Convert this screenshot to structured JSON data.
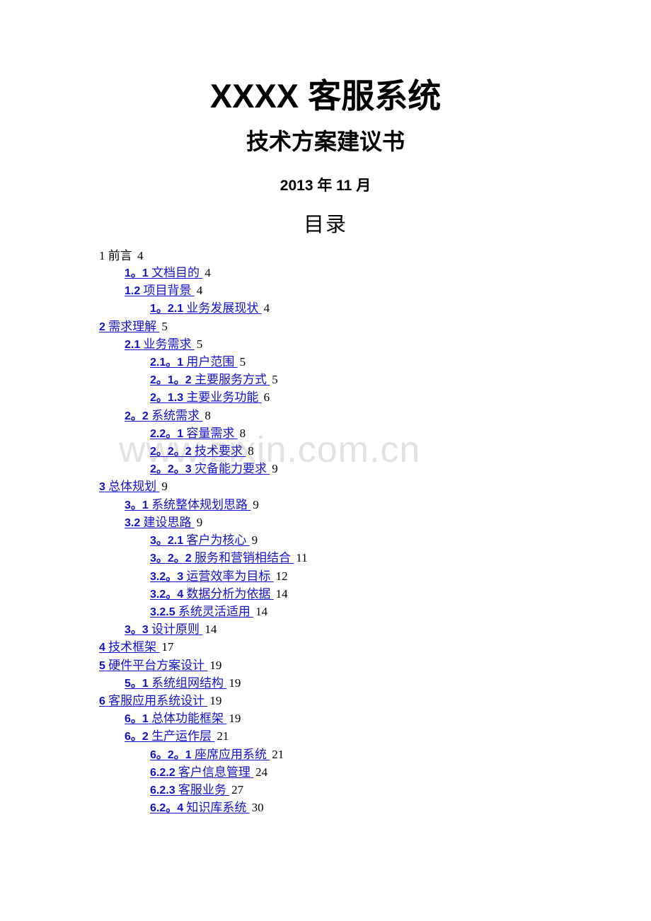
{
  "document": {
    "title": "XXXX 客服系统",
    "subtitle": "技术方案建议书",
    "date": "2013 年 11 月",
    "toc_heading": "目录",
    "watermark": "www.zixin.com.cn",
    "link_color": "#1111cc",
    "text_color": "#000000",
    "watermark_color": "#e2e2e2"
  },
  "toc": {
    "entries": [
      {
        "level": 1,
        "num": "1",
        "text": "前言",
        "page": "4",
        "link": false
      },
      {
        "level": 2,
        "num": "1。1",
        "text": "文档目的",
        "page": "4",
        "link": true
      },
      {
        "level": 2,
        "num": "1.2",
        "text": "项目背景",
        "page": "4",
        "link": true
      },
      {
        "level": 3,
        "num": "1。2.1",
        "text": "业务发展现状",
        "page": "4",
        "link": true
      },
      {
        "level": 1,
        "num": "2",
        "text": "需求理解",
        "page": "5",
        "link": true
      },
      {
        "level": 2,
        "num": "2.1",
        "text": "业务需求",
        "page": "5",
        "link": true
      },
      {
        "level": 3,
        "num": "2.1。1",
        "text": "用户范围",
        "page": "5",
        "link": true
      },
      {
        "level": 3,
        "num": "2。1。2",
        "text": "主要服务方式",
        "page": "5",
        "link": true
      },
      {
        "level": 3,
        "num": "2。1.3",
        "text": "主要业务功能",
        "page": "6",
        "link": true
      },
      {
        "level": 2,
        "num": "2。2",
        "text": "系统需求",
        "page": "8",
        "link": true
      },
      {
        "level": 3,
        "num": "2.2。1",
        "text": "容量需求",
        "page": "8",
        "link": true
      },
      {
        "level": 3,
        "num": "2。2。2",
        "text": "技术要求",
        "page": "8",
        "link": true
      },
      {
        "level": 3,
        "num": "2。2。3",
        "text": "灾备能力要求",
        "page": "9",
        "link": true
      },
      {
        "level": 1,
        "num": "3",
        "text": "总体规划",
        "page": "9",
        "link": true
      },
      {
        "level": 2,
        "num": "3。1",
        "text": "系统整体规划思路",
        "page": "9",
        "link": true
      },
      {
        "level": 2,
        "num": "3.2",
        "text": "建设思路",
        "page": "9",
        "link": true
      },
      {
        "level": 3,
        "num": "3。2.1",
        "text": "客户为核心",
        "page": "9",
        "link": true
      },
      {
        "level": 3,
        "num": "3。2。2",
        "text": "服务和营销相结合",
        "page": "11",
        "link": true
      },
      {
        "level": 3,
        "num": "3.2。3",
        "text": "运营效率为目标",
        "page": "12",
        "link": true
      },
      {
        "level": 3,
        "num": "3.2。4",
        "text": "数据分析为依据",
        "page": "14",
        "link": true
      },
      {
        "level": 3,
        "num": "3.2.5",
        "text": "系统灵活适用",
        "page": "14",
        "link": true
      },
      {
        "level": 2,
        "num": "3。3",
        "text": "设计原则",
        "page": "14",
        "link": true
      },
      {
        "level": 1,
        "num": "4",
        "text": "技术框架",
        "page": "17",
        "link": true
      },
      {
        "level": 1,
        "num": "5",
        "text": "硬件平台方案设计",
        "page": "19",
        "link": true
      },
      {
        "level": 2,
        "num": "5。1",
        "text": "系统组网结构",
        "page": "19",
        "link": true
      },
      {
        "level": 1,
        "num": "6",
        "text": "客服应用系统设计",
        "page": "19",
        "link": true
      },
      {
        "level": 2,
        "num": "6。1",
        "text": "总体功能框架",
        "page": "19",
        "link": true
      },
      {
        "level": 2,
        "num": "6。2",
        "text": "生产运作层",
        "page": "21",
        "link": true
      },
      {
        "level": 3,
        "num": "6。2。1",
        "text": "座席应用系统",
        "page": "21",
        "link": true
      },
      {
        "level": 3,
        "num": "6.2.2",
        "text": "客户信息管理",
        "page": "24",
        "link": true
      },
      {
        "level": 3,
        "num": "6.2.3",
        "text": "客服业务",
        "page": "27",
        "link": true
      },
      {
        "level": 3,
        "num": "6.2。4",
        "text": "知识库系统",
        "page": "30",
        "link": true
      }
    ]
  }
}
